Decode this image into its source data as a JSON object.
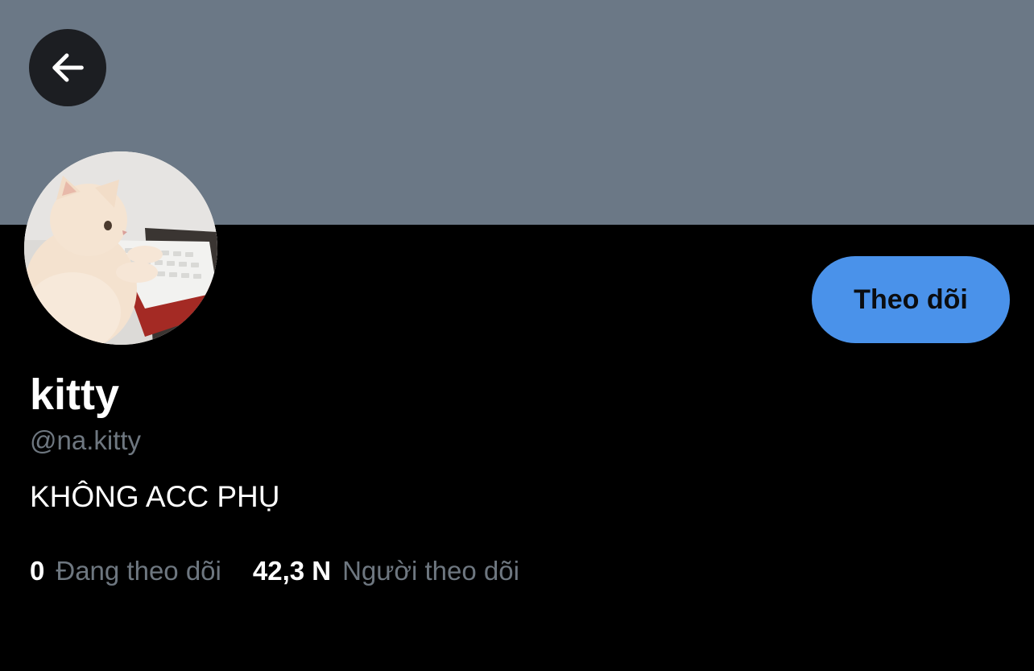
{
  "colors": {
    "banner": "#6b7886",
    "background": "#000000",
    "accent_button": "#4a92ea",
    "muted_text": "#6e7780",
    "primary_text": "#ffffff"
  },
  "header": {
    "back_icon": "arrow-left-icon"
  },
  "profile": {
    "avatar_description_icon": "cat-at-keyboard-avatar",
    "display_name": "kitty",
    "handle": "@na.kitty",
    "bio": "KHÔNG ACC PHỤ",
    "follow_label": "Theo dõi"
  },
  "stats": {
    "following_count": "0",
    "following_label": "Đang theo dõi",
    "followers_count": "42,3 N",
    "followers_label": "Người theo dõi"
  }
}
